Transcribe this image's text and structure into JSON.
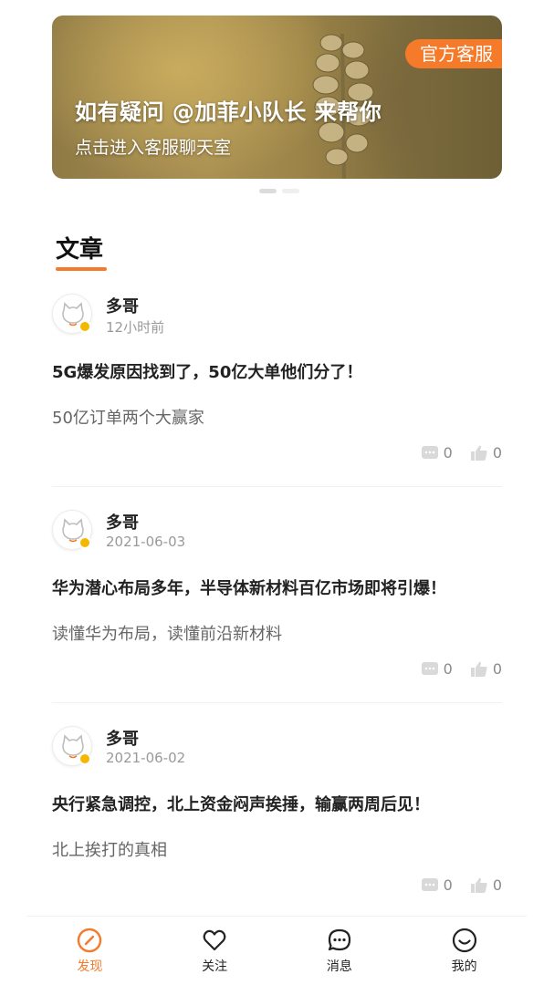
{
  "banner": {
    "tag": "官方客服",
    "title": "如有疑问 @加菲小队长 来帮你",
    "subtitle": "点击进入客服聊天室"
  },
  "section": {
    "title": "文章"
  },
  "articles": [
    {
      "author": "多哥",
      "time": "12小时前",
      "title": "5G爆发原因找到了，50亿大单他们分了！",
      "summary": "50亿订单两个大赢家",
      "comments": "0",
      "likes": "0"
    },
    {
      "author": "多哥",
      "time": "2021-06-03",
      "title": "华为潜心布局多年，半导体新材料百亿市场即将引爆！",
      "summary": "读懂华为布局，读懂前沿新材料",
      "comments": "0",
      "likes": "0"
    },
    {
      "author": "多哥",
      "time": "2021-06-02",
      "title": "央行紧急调控，北上资金闷声挨捶，输赢两周后见！",
      "summary": "北上挨打的真相",
      "comments": "0",
      "likes": "0"
    }
  ],
  "tabbar": [
    {
      "label": "发现",
      "icon": "compass-icon",
      "active": true
    },
    {
      "label": "关注",
      "icon": "heart-icon",
      "active": false
    },
    {
      "label": "消息",
      "icon": "chat-icon",
      "active": false
    },
    {
      "label": "我的",
      "icon": "smile-icon",
      "active": false
    }
  ],
  "colors": {
    "accent": "#f57a2a",
    "badge": "#f5b800"
  }
}
